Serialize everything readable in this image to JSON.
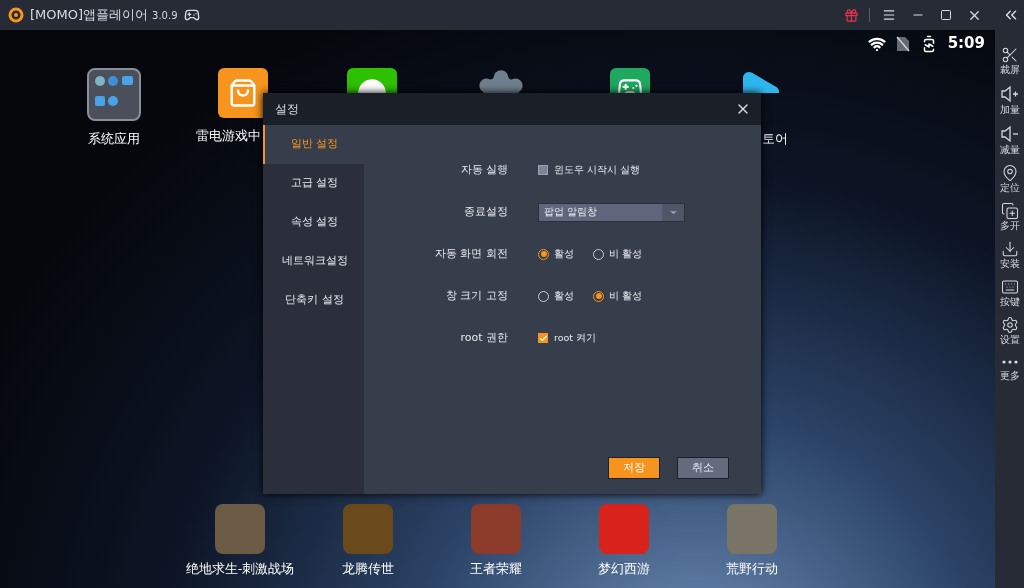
{
  "app_window": {
    "title": "[MOMO]앱플레이어",
    "version": "3.0.9"
  },
  "status_bar": {
    "time": "5:09"
  },
  "sidebar": {
    "items": [
      {
        "label": "裁屏",
        "kind": "scissors"
      },
      {
        "label": "加量",
        "kind": "volume-up"
      },
      {
        "label": "减量",
        "kind": "volume-down"
      },
      {
        "label": "定位",
        "kind": "location"
      },
      {
        "label": "多开",
        "kind": "multi"
      },
      {
        "label": "安装",
        "kind": "apk"
      },
      {
        "label": "按键",
        "kind": "keyboard"
      },
      {
        "label": "设置",
        "kind": "settings"
      },
      {
        "label": "更多",
        "kind": "more"
      }
    ]
  },
  "desktop": {
    "top_icons": [
      {
        "label": "系统应用",
        "kind": "folder"
      },
      {
        "label": "雷电游戏中",
        "kind": "store"
      },
      {
        "kind": "chat"
      },
      {
        "kind": "gear"
      },
      {
        "kind": "games"
      },
      {
        "label": "토어",
        "kind": "play"
      }
    ],
    "dock": [
      {
        "label": "绝地求生-刺激战场",
        "color": "#6b5a44"
      },
      {
        "label": "龙腾传世",
        "color": "#6a4a1a"
      },
      {
        "label": "王者荣耀",
        "color": "#8c3a2a"
      },
      {
        "label": "梦幻西游",
        "color": "#d8231c"
      },
      {
        "label": "荒野行动",
        "color": "#7a7466"
      }
    ]
  },
  "dialog": {
    "title": "설정",
    "tabs": [
      {
        "label": "일반 설정",
        "selected": true
      },
      {
        "label": "고급 설정",
        "selected": false
      },
      {
        "label": "속성 설정",
        "selected": false
      },
      {
        "label": "네트워크설정",
        "selected": false
      },
      {
        "label": "단축키 설정",
        "selected": false
      }
    ],
    "rows": [
      {
        "label": "자동 실행",
        "kind": "checkbox",
        "options": [
          {
            "label": "윈도우 시작시 실행",
            "checked": false
          }
        ]
      },
      {
        "label": "종료설정",
        "kind": "select",
        "value": "팝업 알림창"
      },
      {
        "label": "자동 화면 회전",
        "kind": "radio",
        "options": [
          {
            "label": "활성",
            "selected": true
          },
          {
            "label": "비 활성",
            "selected": false
          }
        ]
      },
      {
        "label": "창 크기 고정",
        "kind": "radio",
        "options": [
          {
            "label": "활성",
            "selected": false
          },
          {
            "label": "비 활성",
            "selected": true
          }
        ]
      },
      {
        "label": "root 권한",
        "kind": "checkbox",
        "options": [
          {
            "label": "root 켜기",
            "checked": true
          }
        ]
      }
    ],
    "buttons": [
      {
        "label": "저장",
        "kind": "primary"
      },
      {
        "label": "취소",
        "kind": "secondary"
      }
    ]
  }
}
